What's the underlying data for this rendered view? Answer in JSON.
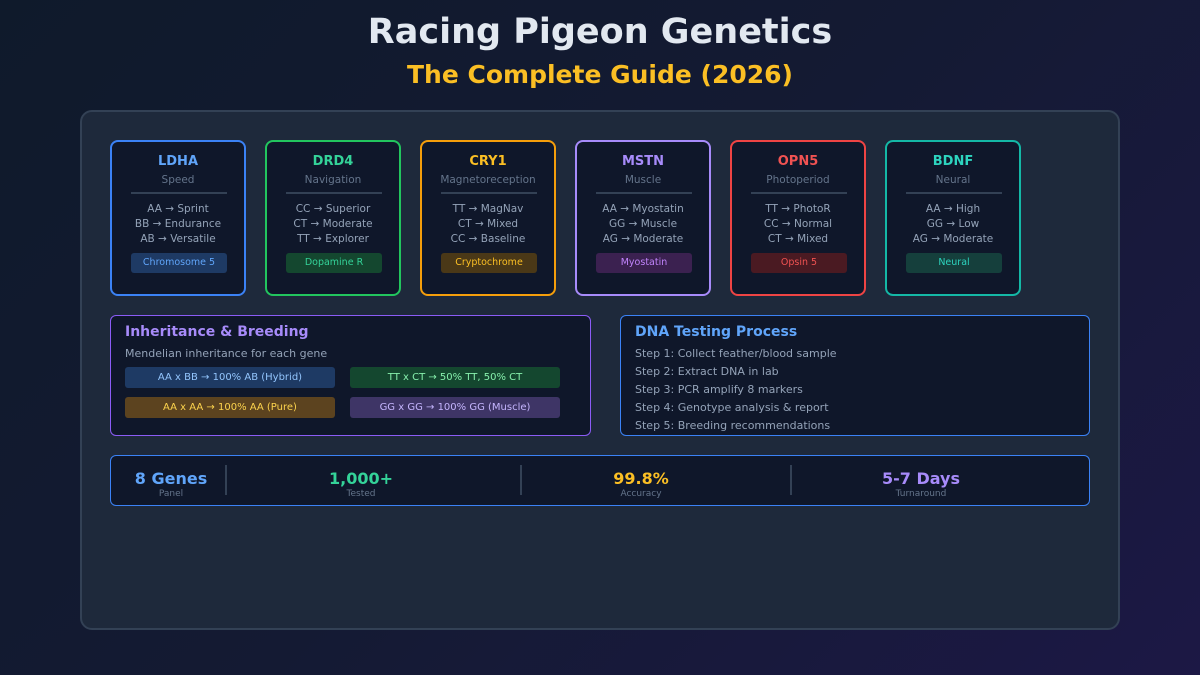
{
  "header": {
    "title": "Racing Pigeon Genetics",
    "subtitle": "The Complete Guide (2026)"
  },
  "colors": {
    "blue": "#60a5fa",
    "green": "#34d399",
    "yellow": "#fbbf24",
    "purple": "#a78bfa",
    "red": "#f05252",
    "teal": "#2dd4bf"
  },
  "genes": [
    {
      "name": "LDHA",
      "trait": "Speed",
      "lines": [
        "AA → Sprint",
        "BB → Endurance",
        "AB → Versatile"
      ],
      "tag": "Chromosome 5"
    },
    {
      "name": "DRD4",
      "trait": "Navigation",
      "lines": [
        "CC → Superior",
        "CT → Moderate",
        "TT → Explorer"
      ],
      "tag": "Dopamine R"
    },
    {
      "name": "CRY1",
      "trait": "Magnetoreception",
      "lines": [
        "TT → MagNav",
        "CT → Mixed",
        "CC → Baseline"
      ],
      "tag": "Cryptochrome"
    },
    {
      "name": "MSTN",
      "trait": "Muscle",
      "lines": [
        "AA → Myostatin",
        "GG → Muscle",
        "AG → Moderate"
      ],
      "tag": "Myostatin"
    },
    {
      "name": "OPN5",
      "trait": "Photoperiod",
      "lines": [
        "TT → PhotoR",
        "CC → Normal",
        "CT → Mixed"
      ],
      "tag": "Opsin 5"
    },
    {
      "name": "BDNF",
      "trait": "Neural",
      "lines": [
        "AA → High",
        "GG → Low",
        "AG → Moderate"
      ],
      "tag": "Neural"
    }
  ],
  "inheritance": {
    "title": "Inheritance & Breeding",
    "subtitle": "Mendelian inheritance for each gene",
    "crosses": [
      "AA x BB → 100% AB (Hybrid)",
      "TT x CT → 50% TT, 50% CT",
      "AA x AA → 100% AA (Pure)",
      "GG x GG → 100% GG (Muscle)"
    ]
  },
  "dna_testing": {
    "title": "DNA Testing Process",
    "steps": [
      "Step 1: Collect feather/blood sample",
      "Step 2: Extract DNA in lab",
      "Step 3: PCR amplify 8 markers",
      "Step 4: Genotype analysis & report",
      "Step 5: Breeding recommendations"
    ]
  },
  "stats": [
    {
      "value": "8 Genes",
      "label": "Panel"
    },
    {
      "value": "1,000+",
      "label": "Tested"
    },
    {
      "value": "99.8%",
      "label": "Accuracy"
    },
    {
      "value": "5-7 Days",
      "label": "Turnaround"
    }
  ]
}
